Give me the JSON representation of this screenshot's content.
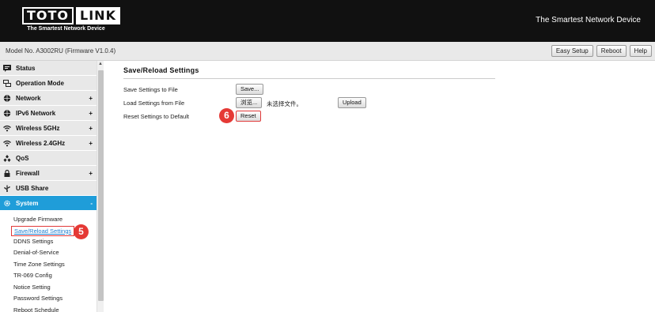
{
  "header": {
    "logo_left": "TOTO",
    "logo_right": "LINK",
    "logo_tagline": "The Smartest Network Device",
    "slogan": "The Smartest Network Device"
  },
  "model_bar": {
    "model_text": "Model No. A3002RU (Firmware V1.0.4)",
    "buttons": [
      "Easy Setup",
      "Reboot",
      "Help"
    ]
  },
  "sidebar": {
    "items": [
      {
        "label": "Status",
        "icon": "status-icon",
        "expandable": false
      },
      {
        "label": "Operation Mode",
        "icon": "operation-mode-icon",
        "expandable": false
      },
      {
        "label": "Network",
        "icon": "globe-icon",
        "expandable": true
      },
      {
        "label": "IPv6 Network",
        "icon": "globe-icon",
        "expandable": true
      },
      {
        "label": "Wireless 5GHz",
        "icon": "wifi-icon",
        "expandable": true
      },
      {
        "label": "Wireless 2.4GHz",
        "icon": "wifi-icon",
        "expandable": true
      },
      {
        "label": "QoS",
        "icon": "qos-icon",
        "expandable": false
      },
      {
        "label": "Firewall",
        "icon": "lock-icon",
        "expandable": true
      },
      {
        "label": "USB Share",
        "icon": "usb-icon",
        "expandable": false
      },
      {
        "label": "System",
        "icon": "gear-icon",
        "expandable": true
      }
    ],
    "plus_symbol": "+",
    "minus_symbol": "-",
    "active_item": "System",
    "system_subitems": [
      "Upgrade Firmware",
      "Save/Reload Settings",
      "DDNS Settings",
      "Denial-of-Service",
      "Time Zone Settings",
      "TR-069 Config",
      "Notice Setting",
      "Password Settings",
      "Reboot Schedule"
    ],
    "current_subitem": "Save/Reload Settings"
  },
  "markers": {
    "step5": "5",
    "step6": "6"
  },
  "content": {
    "title": "Save/Reload Settings",
    "save_label": "Save Settings to File",
    "save_button": "Save...",
    "load_label": "Load Settings from File",
    "browse_button": "浏览...",
    "no_file_text": "未选择文件。",
    "upload_button": "Upload",
    "reset_label": "Reset Settings to Default",
    "reset_button": "Reset"
  },
  "colors": {
    "header_bg": "#111111",
    "active_menu": "#1f9dd9",
    "highlight": "#e03a3a",
    "marker": "#e53935"
  }
}
